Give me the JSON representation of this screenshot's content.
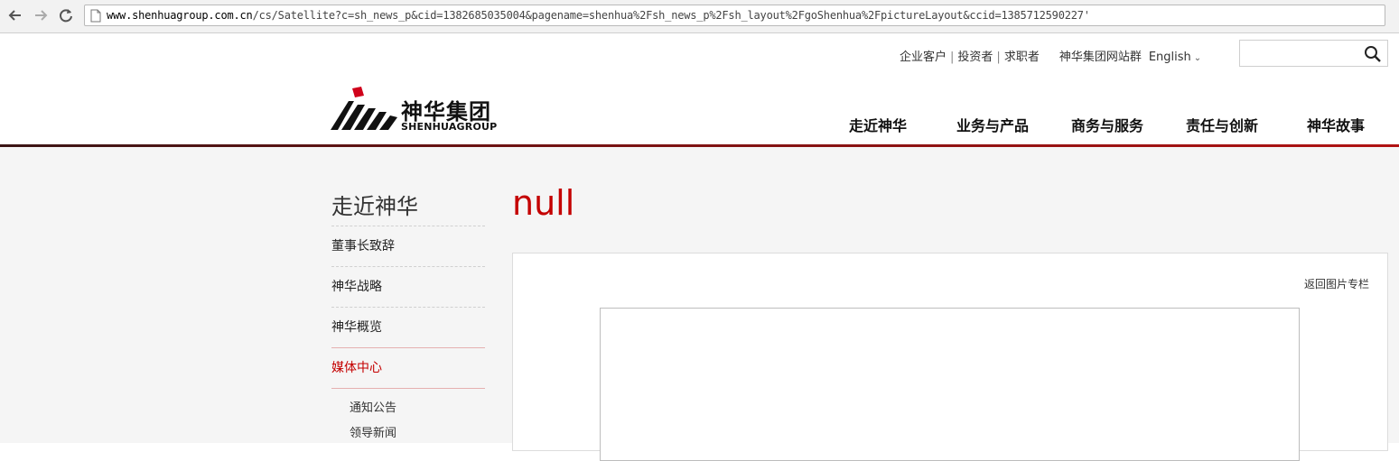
{
  "browser": {
    "url_domain": "www.shenhuagroup.com.cn",
    "url_path": "/cs/Satellite?c=sh_news_p&cid=1382685035004&pagename=shenhua%2Fsh_news_p%2Fsh_layout%2FgoShenhua%2FpictureLayout&ccid=1385712590227'"
  },
  "header": {
    "utility_links": [
      "企业客户",
      "投资者",
      "求职者"
    ],
    "separator": "|",
    "group_sites": "神华集团网站群",
    "language": "English",
    "search": {
      "value": "",
      "placeholder": ""
    }
  },
  "logo": {
    "cn": "神华集团",
    "en": "SHENHUAGROUP"
  },
  "nav": {
    "about": "走近神华",
    "business": "业务与产品",
    "commerce": "商务与服务",
    "responsibility": "责任与创新",
    "stories": "神华故事"
  },
  "sidebar": {
    "title": "走近神华",
    "items": [
      "董事长致辞",
      "神华战略",
      "神华概览",
      "媒体中心"
    ],
    "active_item": "媒体中心",
    "sub_items": [
      "通知公告",
      "领导新闻"
    ]
  },
  "article": {
    "title": "null",
    "back_link": "返回图片专栏"
  },
  "colors": {
    "accent_red": "#c40000",
    "rule_dark": "#3a1414",
    "content_bg": "#f5f5f5"
  }
}
